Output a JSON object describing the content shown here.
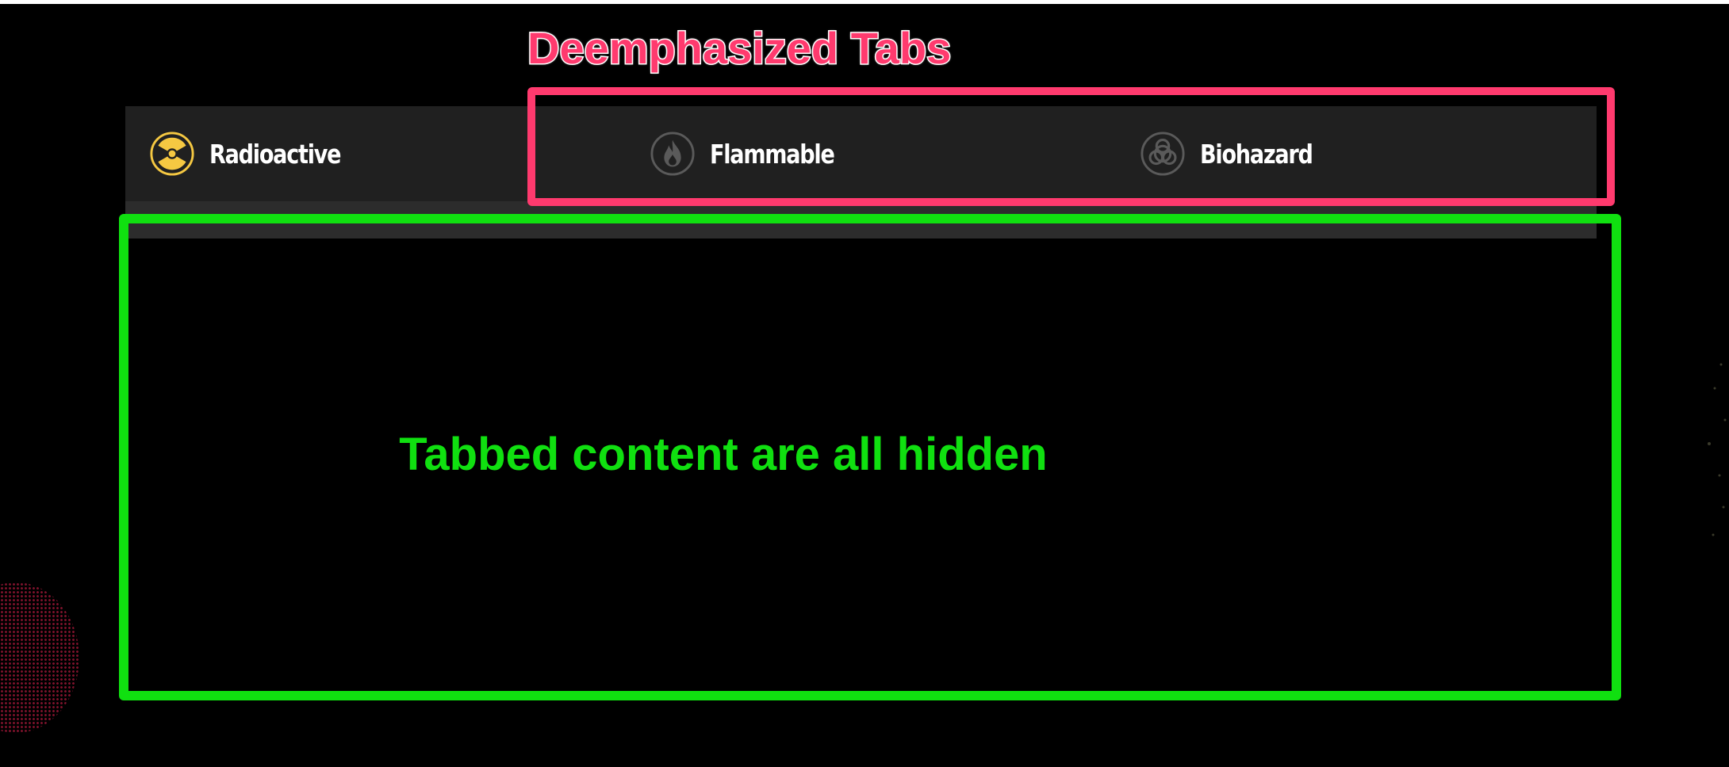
{
  "tabs": [
    {
      "label": "Radioactive",
      "icon": "radioactive-icon",
      "active": true
    },
    {
      "label": "Flammable",
      "icon": "flame-icon",
      "active": false
    },
    {
      "label": "Biohazard",
      "icon": "biohazard-icon",
      "active": false
    }
  ],
  "annotations": {
    "tabs_label": "Deemphasized Tabs",
    "content_label": "Tabbed content are all hidden"
  },
  "colors": {
    "active_icon": "#f5c842",
    "inactive_icon": "#5a5a5a",
    "annotation_pink": "#ff3a6e",
    "annotation_green": "#10e010",
    "tab_bar": "#202020"
  }
}
